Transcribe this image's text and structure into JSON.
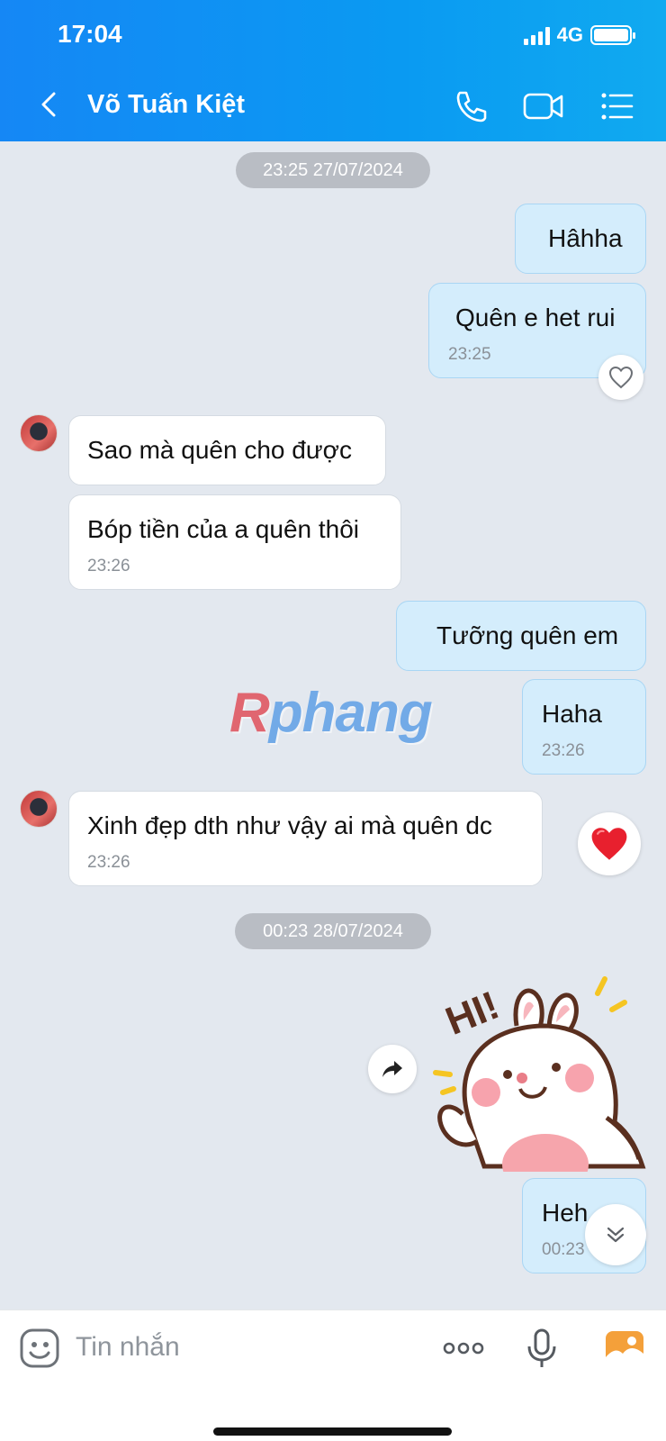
{
  "status_bar": {
    "time": "17:04",
    "network": "4G"
  },
  "header": {
    "contact_name": "Võ Tuấn Kiệt"
  },
  "messages": {
    "stamp1": "23:25 27/07/2024",
    "m1": {
      "text": "Hâhha"
    },
    "m2": {
      "text": "Quên e het rui",
      "time": "23:25"
    },
    "m3": {
      "text": "Sao mà quên cho được"
    },
    "m4": {
      "text": "Bóp tiền của a quên thôi",
      "time": "23:26"
    },
    "m5": {
      "text": "Tưỡng quên em"
    },
    "m6": {
      "text": "Haha",
      "time": "23:26"
    },
    "m7": {
      "text": "Xinh đẹp dth như vậy ai mà quên dc",
      "time": "23:26"
    },
    "stamp2": "00:23 28/07/2024",
    "m8": {
      "text": "Heh",
      "time": "00:23"
    }
  },
  "sticker": {
    "text": "HI!"
  },
  "watermark": {
    "r": "R",
    "rest": "phang"
  },
  "composer": {
    "placeholder": "Tin nhắn"
  },
  "colors": {
    "header": "#1587f5",
    "outgoing_bubble": "#d4edfc",
    "incoming_bubble": "#ffffff",
    "background": "#e3e8ef",
    "heart": "#e8202e"
  },
  "icons": [
    "back-icon",
    "phone-icon",
    "video-icon",
    "list-icon",
    "heart-icon",
    "share-icon",
    "scroll-down-icon",
    "sticker-icon",
    "more-icon",
    "mic-icon",
    "image-icon"
  ]
}
